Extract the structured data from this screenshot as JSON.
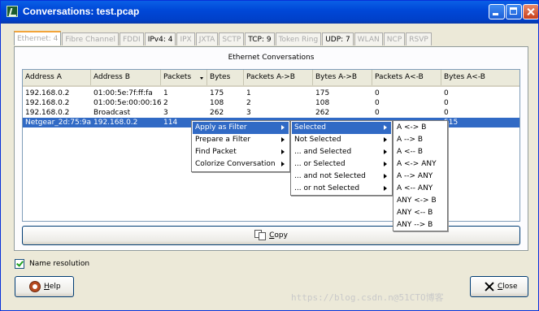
{
  "window": {
    "title": "Conversations: test.pcap"
  },
  "tabs": [
    {
      "label": "Ethernet: 4",
      "state": "active"
    },
    {
      "label": "Fibre Channel",
      "state": "disabled"
    },
    {
      "label": "FDDI",
      "state": "disabled"
    },
    {
      "label": "IPv4: 4",
      "state": "enabled"
    },
    {
      "label": "IPX",
      "state": "disabled"
    },
    {
      "label": "JXTA",
      "state": "disabled"
    },
    {
      "label": "SCTP",
      "state": "disabled"
    },
    {
      "label": "TCP: 9",
      "state": "enabled"
    },
    {
      "label": "Token Ring",
      "state": "disabled"
    },
    {
      "label": "UDP: 7",
      "state": "enabled"
    },
    {
      "label": "WLAN",
      "state": "disabled"
    },
    {
      "label": "NCP",
      "state": "disabled"
    },
    {
      "label": "RSVP",
      "state": "disabled"
    }
  ],
  "panel": {
    "title": "Ethernet Conversations"
  },
  "table": {
    "columns": [
      "Address A",
      "Address B",
      "Packets",
      "Bytes",
      "Packets A->B",
      "Bytes A->B",
      "Packets A<-B",
      "Bytes A<-B"
    ],
    "sorted_column": "Packets",
    "rows": [
      [
        "192.168.0.2",
        "01:00:5e:7f:ff:fa",
        "1",
        "175",
        "1",
        "175",
        "0",
        "0"
      ],
      [
        "192.168.0.2",
        "01:00:5e:00:00:16",
        "2",
        "108",
        "2",
        "108",
        "0",
        "0"
      ],
      [
        "192.168.0.2",
        "Broadcast",
        "3",
        "262",
        "3",
        "262",
        "0",
        "0"
      ],
      [
        "Netgear_2d:75:9a",
        "192.168.0.2",
        "114",
        "",
        "",
        "",
        "",
        "515"
      ]
    ],
    "selected_row": 3
  },
  "copy_button": {
    "label": "Copy",
    "mnemonic": "C",
    "rest": "opy"
  },
  "name_resolution": {
    "label": "Name resolution",
    "checked": true
  },
  "help_button": {
    "label": "Help",
    "mnemonic": "H",
    "rest": "elp"
  },
  "close_button": {
    "label": "Close",
    "mnemonic": "C",
    "rest": "lose"
  },
  "context_menu": {
    "items": [
      "Apply as Filter",
      "Prepare a Filter",
      "Find Packet",
      "Colorize Conversation"
    ],
    "highlighted": 0
  },
  "filter_submenu": {
    "items": [
      "Selected",
      "Not Selected",
      "... and Selected",
      "... or Selected",
      "... and not Selected",
      "... or not Selected"
    ],
    "highlighted": 0
  },
  "direction_submenu": {
    "items": [
      "A <-> B",
      "A --> B",
      "A <-- B",
      "A <-> ANY",
      "A --> ANY",
      "A <-- ANY",
      "ANY <-> B",
      "ANY <-- B",
      "ANY --> B"
    ]
  },
  "watermark": "https://blog.csdn.n@51CTO博客",
  "colors": {
    "title_bar": "#0054e3",
    "selection": "#316ac5",
    "active_tab_accent": "#f2a43a"
  },
  "icons": [
    "app-icon",
    "minimize-icon",
    "maximize-icon",
    "close-window-icon",
    "copy-icon",
    "help-lifebuoy-icon",
    "close-x-icon",
    "checkbox-check-icon"
  ]
}
